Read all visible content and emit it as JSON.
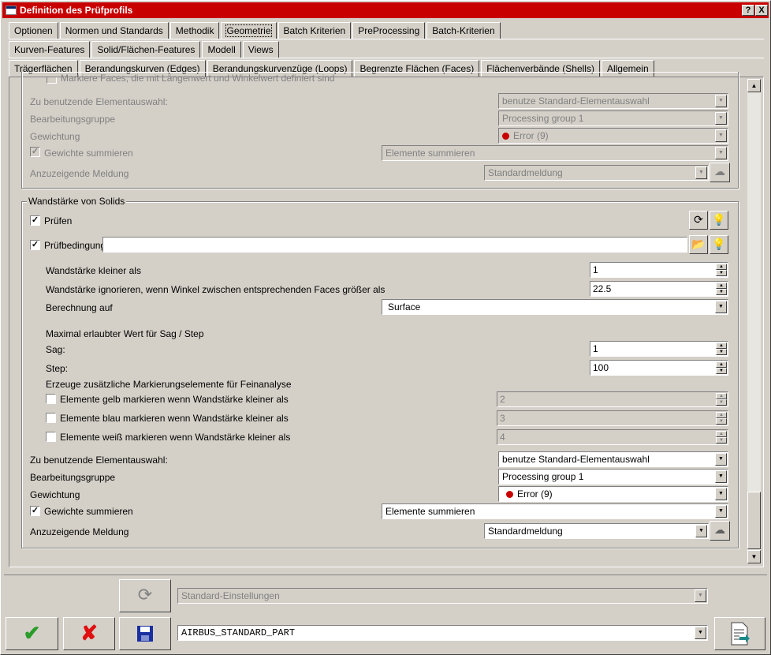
{
  "window": {
    "title": "Definition des Prüfprofils",
    "help_btn": "?",
    "close_btn": "X"
  },
  "tabs_row1": [
    "Optionen",
    "Normen und Standards",
    "Methodik",
    "Geometrie",
    "Batch Kriterien",
    "PreProcessing",
    "Batch-Kriterien"
  ],
  "tabs_row2": [
    "Kurven-Features",
    "Solid/Flächen-Features",
    "Modell",
    "Views"
  ],
  "tabs_row3": [
    "Trägerflächen",
    "Berandungskurven (Edges)",
    "Berandungskurvenzüge (Loops)",
    "Begrenzte Flächen (Faces)",
    "Flächenverbände (Shells)",
    "Allgemein"
  ],
  "upper": {
    "cut_label": "Markiere Faces, die mit Längenwert und Winkelwert definiert sind",
    "element_selection_label": "Zu benutzende Elementauswahl:",
    "element_selection_value": "benutze Standard-Elementauswahl",
    "processing_group_label": "Bearbeitungsgruppe",
    "processing_group_value": "Processing group 1",
    "weighting_label": "Gewichtung",
    "weighting_value": "Error (9)",
    "sum_weights_label": "Gewichte summieren",
    "sum_weights_value": "Elemente summieren",
    "message_label": "Anzuzeigende Meldung",
    "message_value": "Standardmeldung"
  },
  "wall": {
    "legend": "Wandstärke von Solids",
    "check_label": "Prüfen",
    "condition_label": "Prüfbedingung",
    "condition_value": "",
    "thickness_less_label": "Wandstärke kleiner als",
    "thickness_less_value": "1",
    "ignore_angle_label": "Wandstärke ignorieren, wenn Winkel zwischen entsprechenden Faces größer als",
    "ignore_angle_value": "22.5",
    "compute_on_label": "Berechnung auf",
    "compute_on_value": "Surface",
    "max_sag_label": "Maximal erlaubter Wert für Sag / Step",
    "sag_label": "Sag:",
    "sag_value": "1",
    "step_label": "Step:",
    "step_value": "100",
    "extra_markers_label": "Erzeuge zusätzliche Markierungselemente für Feinanalyse",
    "yellow_label": "Elemente gelb markieren wenn Wandstärke kleiner als",
    "yellow_value": "2",
    "blue_label": "Elemente blau markieren wenn Wandstärke kleiner als",
    "blue_value": "3",
    "white_label": "Elemente weiß markieren wenn Wandstärke kleiner als",
    "white_value": "4",
    "element_selection_label": "Zu benutzende Elementauswahl:",
    "element_selection_value": "benutze Standard-Elementauswahl",
    "processing_group_label": "Bearbeitungsgruppe",
    "processing_group_value": "Processing group 1",
    "weighting_label": "Gewichtung",
    "weighting_value": "Error (9)",
    "sum_weights_label": "Gewichte summieren",
    "sum_weights_value": "Elemente summieren",
    "message_label": "Anzuzeigende Meldung",
    "message_value": "Standardmeldung"
  },
  "footer": {
    "settings_value": "Standard-Einstellungen",
    "profile_value": "AIRBUS_STANDARD_PART"
  },
  "colors": {
    "titlebar": "#c80000",
    "ok": "#2a9d2a",
    "cancel": "#e01010",
    "save": "#1a2fa0",
    "error_dot": "#c80000"
  }
}
